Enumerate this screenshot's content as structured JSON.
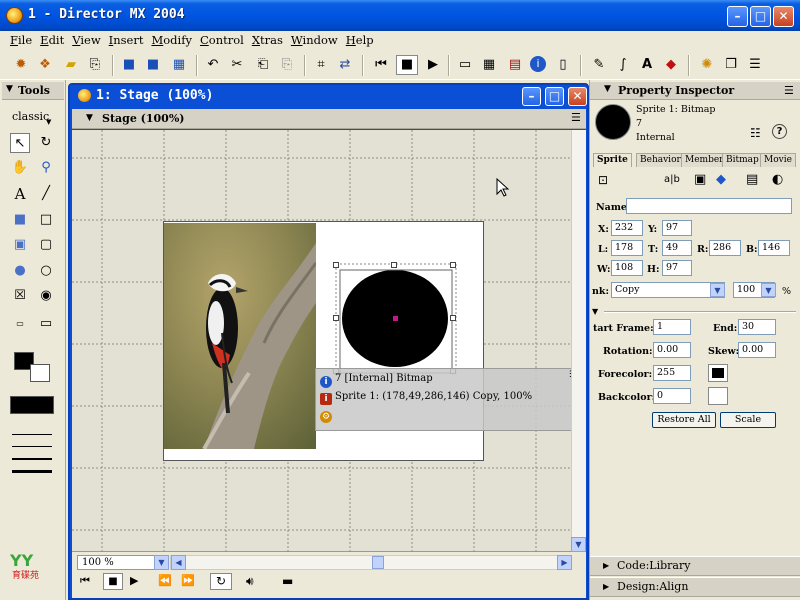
{
  "window": {
    "title": "1 - Director MX 2004"
  },
  "menu": [
    "File",
    "Edit",
    "View",
    "Insert",
    "Modify",
    "Control",
    "Xtras",
    "Window",
    "Help"
  ],
  "tools_panel": {
    "title": "Tools",
    "mode": "classic"
  },
  "stage": {
    "window_title": "1: Stage (100%)",
    "toolbar_label": "Stage (100%)",
    "zoom": "100 %"
  },
  "overlay": {
    "line1": "7 [Internal] Bitmap",
    "line2": "Sprite 1: (178,49,286,146) Copy, 100%"
  },
  "property_inspector": {
    "title": "Property Inspector",
    "sprite_line": "Sprite 1: Bitmap",
    "member_num": "7",
    "cast": "Internal",
    "tabs": [
      "Sprite",
      "Behavior",
      "Member",
      "Bitmap",
      "Movie"
    ],
    "name_label": "Name:",
    "name_value": "",
    "x_label": "X:",
    "x": "232",
    "y_label": "Y:",
    "y": "97",
    "l_label": "L:",
    "l": "178",
    "t_label": "T:",
    "t": "49",
    "r_label": "R:",
    "r": "286",
    "b_label": "B:",
    "b": "146",
    "w_label": "W:",
    "w": "108",
    "h_label": "H:",
    "h": "97",
    "ink_label": "nk:",
    "ink": "Copy",
    "blend": "100",
    "blend_unit": "%",
    "start_frame_label": "tart Frame:",
    "start_frame": "1",
    "end_label": "End:",
    "end": "30",
    "rotation_label": "Rotation:",
    "rotation": "0.00",
    "skew_label": "Skew:",
    "skew": "0.00",
    "forecolor_label": "Forecolor:",
    "forecolor": "255",
    "backcolor_label": "Backcolor:",
    "backcolor": "0",
    "restore_all": "Restore All",
    "scale": "Scale"
  },
  "panels": {
    "code_library": "Code:Library",
    "design_align": "Design:Align"
  },
  "colors": {
    "title_bar": "#0054e3",
    "stage_bg": "#e3e1d3",
    "sprite_circle": "#000000",
    "registration_point": "#c2188c"
  }
}
